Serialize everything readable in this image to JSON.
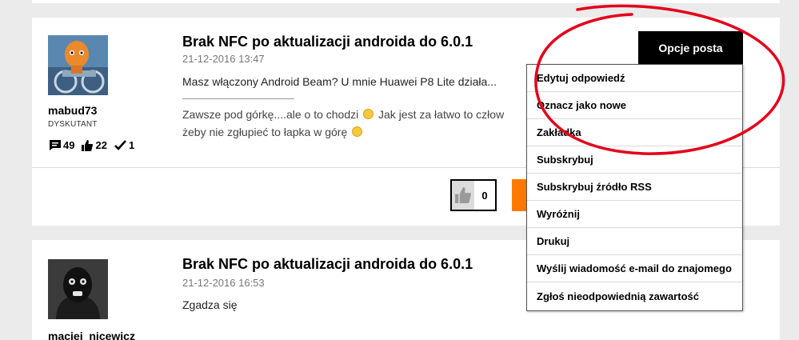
{
  "annotation_color": "#e3001b",
  "accent_color": "#ff7900",
  "posts": [
    {
      "title": "Brak NFC po aktualizacji androida do 6.0.1",
      "date": "21-12-2016 13:47",
      "body": "Masz włączony Android Beam? U mnie Huawei P8 Lite działa...",
      "signature_line1": "Zawsze pod górkę....ale o to chodzi",
      "signature_line1b": "Jak jest za łatwo to człow",
      "signature_line2": "żeby nie zgłupieć to łapka w górę",
      "author": {
        "username": "mabud73",
        "rank": "DYSKUTANT",
        "stats": {
          "messages": "49",
          "kudos": "22",
          "solutions": "1"
        }
      },
      "kudos_count": "0"
    },
    {
      "title": "Brak NFC po aktualizacji androida do 6.0.1",
      "date": "21-12-2016 16:53",
      "body": "Zgadza się",
      "author": {
        "username": "maciej_nicewicz"
      }
    }
  ],
  "options": {
    "button_label": "Opcje posta",
    "items": [
      "Edytuj odpowiedź",
      "Oznacz jako nowe",
      "Zakładka",
      "Subskrybuj",
      "Subskrybuj źródło RSS",
      "Wyróżnij",
      "Drukuj",
      "Wyślij wiadomość e-mail do znajomego",
      "Zgłoś nieodpowiednią zawartość"
    ]
  }
}
